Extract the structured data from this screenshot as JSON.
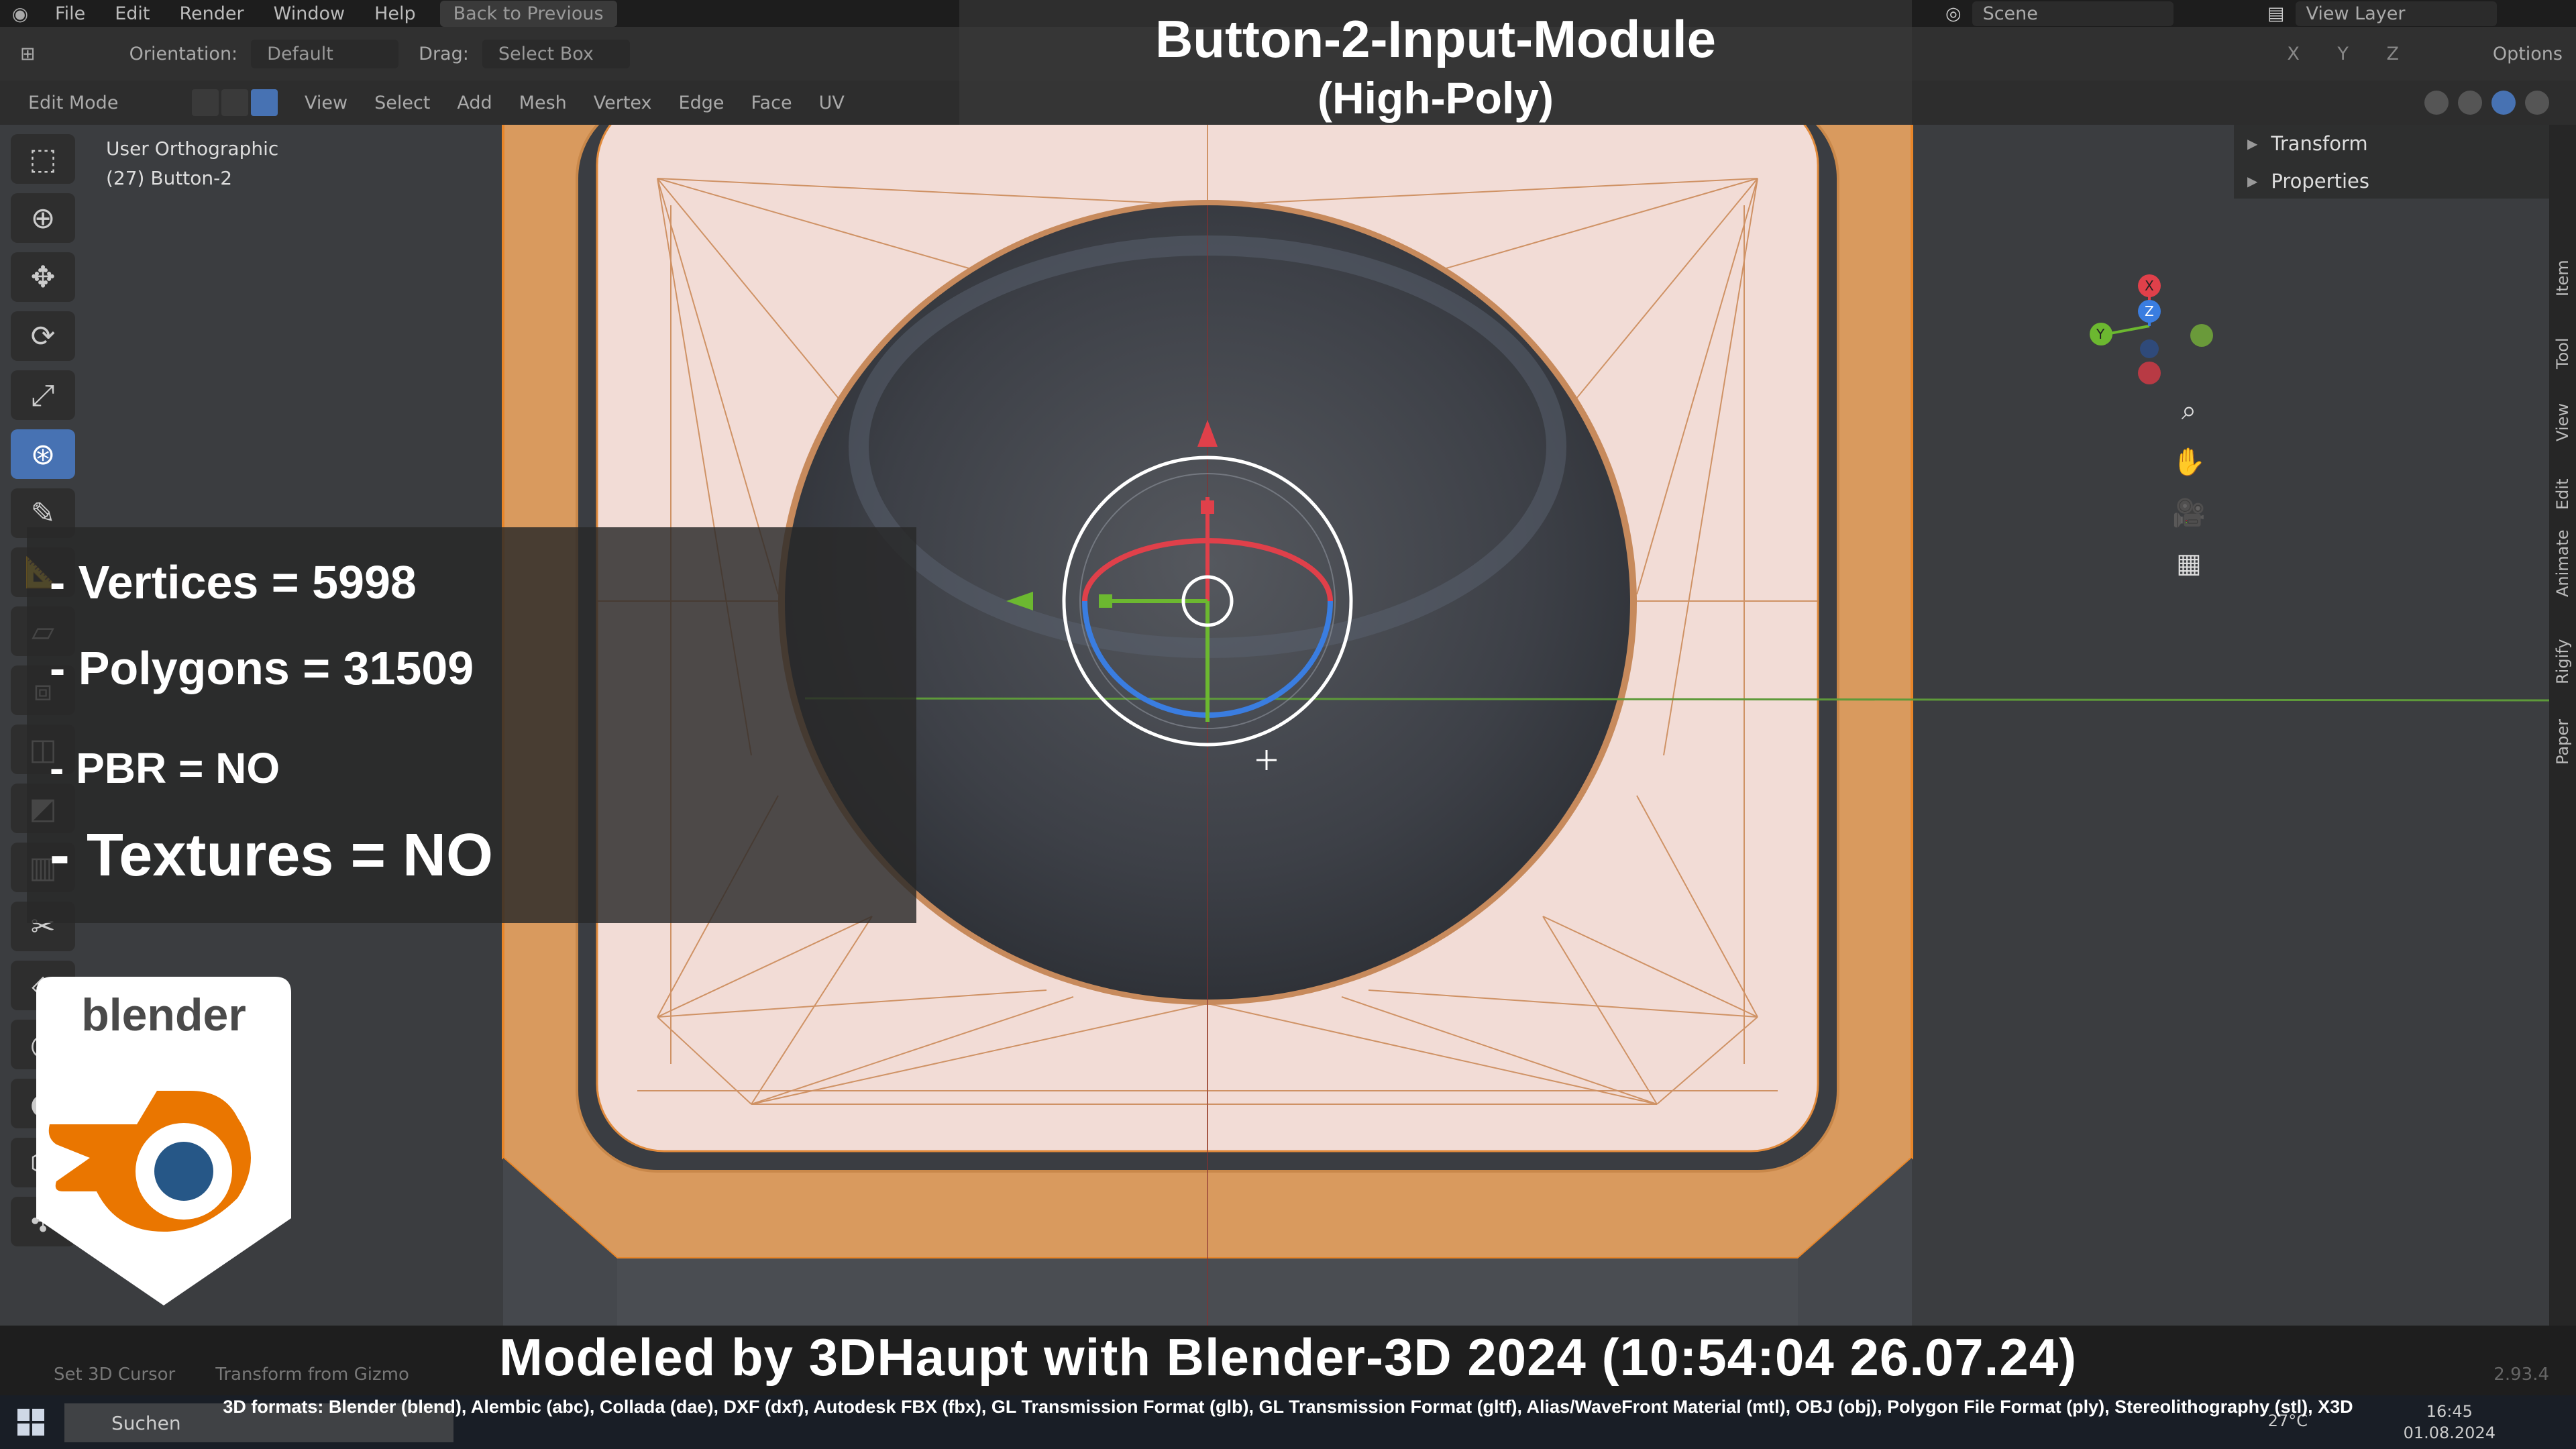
{
  "menubar": {
    "items": [
      "File",
      "Edit",
      "Render",
      "Window",
      "Help"
    ],
    "back_button": "Back to Previous",
    "scene": "Scene",
    "view_layer": "View Layer"
  },
  "header": {
    "orientation_label": "Orientation:",
    "orientation_value": "Default",
    "drag_label": "Drag:",
    "drag_value": "Select Box",
    "axes": "X Y Z",
    "options": "Options",
    "mode": "Edit Mode",
    "menus": [
      "View",
      "Select",
      "Add",
      "Mesh",
      "Vertex",
      "Edge",
      "Face",
      "UV"
    ]
  },
  "viewport": {
    "view_name": "User Orthographic",
    "object_name": "(27) Button-2"
  },
  "npanel": {
    "sections": [
      "Transform",
      "Properties"
    ],
    "tabs": [
      "Item",
      "Tool",
      "View",
      "Edit",
      "Animate",
      "Rigify",
      "Paper"
    ]
  },
  "overlay": {
    "title": "Button-2-Input-Module",
    "subtitle": "(High-Poly)",
    "stats": {
      "vertices": "- Vertices = 5998",
      "polygons": "- Polygons = 31509",
      "pbr": "- PBR =  NO",
      "textures": "- Textures = NO"
    },
    "logo_text": "blender",
    "modeled_by": "Modeled by 3DHaupt with Blender-3D 2024 (10:54:04  26.07.24)",
    "formats": "3D formats: Blender (blend), Alembic (abc), Collada (dae), DXF (dxf), Autodesk FBX (fbx), GL Transmission Format (glb), GL Transmission Format (gltf), Alias/WaveFront Material (mtl), OBJ (obj), Polygon File Format (ply), Stereolithography (stl), X3D"
  },
  "statusbar": {
    "items": [
      "Set 3D Cursor",
      "Transform from Gizmo"
    ],
    "version": "2.93.4"
  },
  "taskbar": {
    "search_placeholder": "Suchen",
    "time": "16:45",
    "date": "01.08.2024",
    "temperature": "27°C"
  },
  "colors": {
    "accent": "#4772b3",
    "mesh_fill": "#f2dcd6",
    "mesh_edge": "#e08a3c",
    "selection_orange": "#e8862a",
    "axis_red": "#e0404a",
    "axis_green": "#6cb830",
    "axis_blue": "#3a7de0"
  }
}
